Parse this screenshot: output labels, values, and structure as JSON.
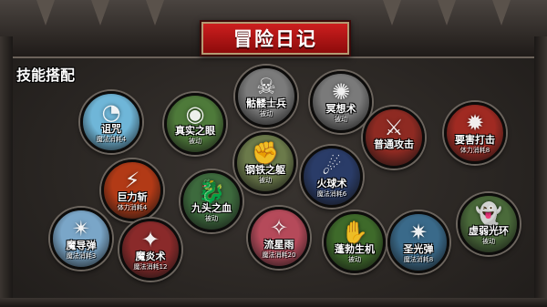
{
  "header": {
    "title": "冒险日记"
  },
  "section": {
    "label": "技能搭配"
  },
  "colors": {
    "banner_red": "#c21515",
    "background": "#2e2a27"
  },
  "skills": [
    {
      "name": "诅咒",
      "sub": "魔法消耗4",
      "icon": "eyes-curse-icon",
      "color": "#6fb6d8"
    },
    {
      "name": "真实之眼",
      "sub": "被动",
      "icon": "eye-icon",
      "color": "#4e7a3a"
    },
    {
      "name": "骷髅士兵",
      "sub": "被动",
      "icon": "skull-icon",
      "color": "#7b7b7b"
    },
    {
      "name": "冥想术",
      "sub": "被动",
      "icon": "meditation-icon",
      "color": "#7a7a7a"
    },
    {
      "name": "普通攻击",
      "sub": "",
      "icon": "sword-icon",
      "color": "#8e2a22"
    },
    {
      "name": "要害打击",
      "sub": "体力消耗8",
      "icon": "target-strike-icon",
      "color": "#a02a22"
    },
    {
      "name": "钢铁之躯",
      "sub": "被动",
      "icon": "iron-fist-icon",
      "color": "#6b7a4a"
    },
    {
      "name": "火球术",
      "sub": "魔法消耗6",
      "icon": "fireball-icon",
      "color": "#2a3c68"
    },
    {
      "name": "巨力斩",
      "sub": "体力消耗4",
      "icon": "claw-slash-icon",
      "color": "#b23a16"
    },
    {
      "name": "九头之血",
      "sub": "被动",
      "icon": "hydra-icon",
      "color": "#3d6a3d"
    },
    {
      "name": "魔导弹",
      "sub": "魔法消耗3",
      "icon": "magic-missile-icon",
      "color": "#7aa6c8"
    },
    {
      "name": "魔炎术",
      "sub": "魔法消耗12",
      "icon": "demon-flame-icon",
      "color": "#8a2a2a"
    },
    {
      "name": "流星雨",
      "sub": "魔法消耗20",
      "icon": "meteor-icon",
      "color": "#b54a5a"
    },
    {
      "name": "蓬勃生机",
      "sub": "被动",
      "icon": "vitality-fist-icon",
      "color": "#3e6a2a"
    },
    {
      "name": "圣光弹",
      "sub": "魔法消耗8",
      "icon": "holy-light-icon",
      "color": "#3a6a8a"
    },
    {
      "name": "虚弱光环",
      "sub": "被动",
      "icon": "ghost-icon",
      "color": "#4a6a3a"
    }
  ]
}
